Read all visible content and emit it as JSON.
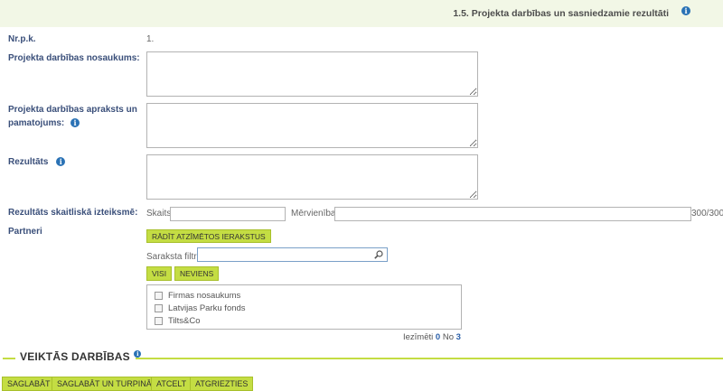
{
  "header": {
    "title": "1.5. Projekta darbības un sasniedzamie rezultāti"
  },
  "form": {
    "nr_label": "Nr.p.k.",
    "nr_value": "1.",
    "name_label": "Projekta darbības nosaukums:",
    "desc_label_line1": "Projekta darbības apraksts un",
    "desc_label_line2": "pamatojums:",
    "result_label": "Rezultāts",
    "numeric_label": "Rezultāts skaitliskā izteiksmē:",
    "count_label": "Skaits",
    "count_value": "",
    "unit_label": "Mērvienība",
    "unit_value": "",
    "char_counter": "300/300",
    "partners_label": "Partneri"
  },
  "partners": {
    "show_selected_button": "RĀDĪT ATZĪMĒTOS IERAKSTUS",
    "filter_label": "Saraksta filtrs",
    "filter_value": "",
    "all_button": "VISI",
    "none_button": "NEVIENS",
    "items": [
      {
        "label": "Firmas nosaukums",
        "checked": false
      },
      {
        "label": "Latvijas Parku fonds",
        "checked": false
      },
      {
        "label": "Tilts&Co",
        "checked": false
      }
    ],
    "selected_label": "Iezīmēti",
    "selected_count": "0",
    "of_label": "No",
    "total_count": "3"
  },
  "actions": {
    "section_title": "VEIKTĀS DARBĪBAS",
    "save": "SAGLABĀT",
    "save_continue": "SAGLABĀT UN TURPINĀT",
    "cancel": "ATCELT",
    "back": "ATGRIEZTIES"
  },
  "colors": {
    "accent": "#c4dd43",
    "header_bg": "#f2f7e6",
    "label": "#3a4f7a",
    "info": "#2a72b5"
  }
}
